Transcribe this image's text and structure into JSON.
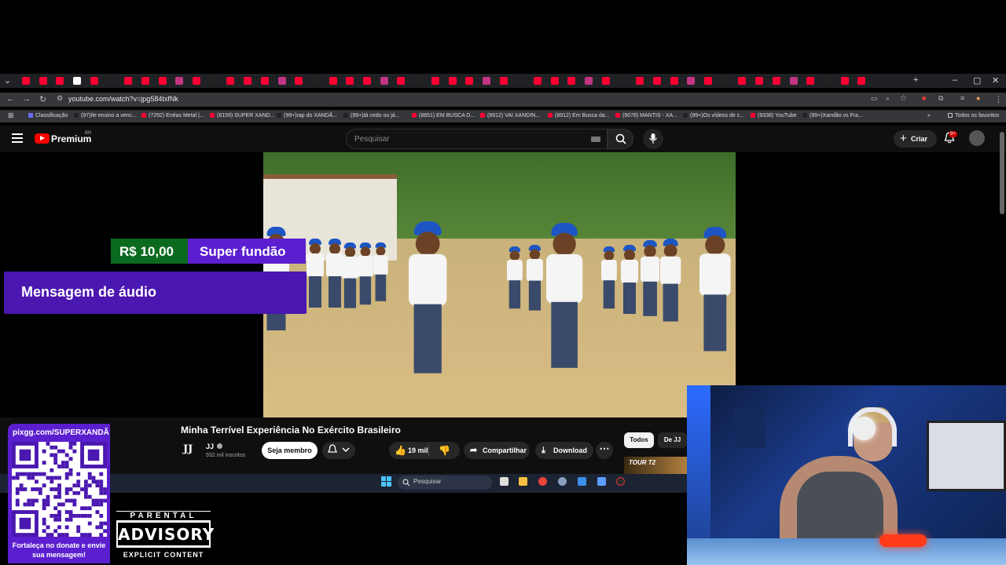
{
  "browser": {
    "url": "youtube.com/watch?v=jpg584txfNk",
    "bookmarks": [
      {
        "label": "Classificação",
        "color": "#6a6cf0"
      },
      {
        "label": "(97)Ile ensino a venc...",
        "color": "#222222"
      },
      {
        "label": "(7292) Enéas Metal |...",
        "color": "#ff0033"
      },
      {
        "label": "(8159) SUPER XAND...",
        "color": "#ff0033"
      },
      {
        "label": "(99+)rap do XANDÃ...",
        "color": "#222222"
      },
      {
        "label": "(99+)tá cedo ou já...",
        "color": "#222222"
      },
      {
        "label": "(8851) EM BUSCA D...",
        "color": "#ff0033"
      },
      {
        "label": "(8912) VAI XANDIN...",
        "color": "#ff0033"
      },
      {
        "label": "(8912) Em Busca da...",
        "color": "#ff0033"
      },
      {
        "label": "(9078) MANTIS - XA...",
        "color": "#ff0033"
      },
      {
        "label": "(99+)Os vídeos de c...",
        "color": "#222222"
      },
      {
        "label": "(9338) YouTube",
        "color": "#ff0033"
      },
      {
        "label": "(99+)Xandão vs Fra...",
        "color": "#222222"
      }
    ],
    "all_bookmarks": "Todos os favoritos"
  },
  "youtube": {
    "brand": "Premium",
    "country": "BR",
    "search_placeholder": "Pesquisar",
    "create_label": "Criar",
    "notification_badge": "9+"
  },
  "superchat": {
    "amount": "R$ 10,00",
    "title": "Super fundão",
    "message": "Mensagem de áudio"
  },
  "video": {
    "title": "Minha Terrível Experiência No Exército Brasileiro",
    "channel_logo": "JJ",
    "channel": "JJ",
    "subscribers": "932 mil inscritos",
    "join_label": "Seja membro",
    "likes": "19 mil",
    "share_label": "Compartilhar",
    "download_label": "Download",
    "more_label": "⋯"
  },
  "filters": {
    "all": "Todos",
    "from_channel": "De JJ"
  },
  "suggestion_thumb_text": "TOUR T2",
  "taskbar": {
    "search_placeholder": "Pesquisar"
  },
  "donate": {
    "url": "pixgg.com/SUPERXANDÃ",
    "text": "Fortaleça no donate e envie sua mensagem!"
  },
  "advisory": {
    "top": "PARENTAL",
    "middle": "ADVISORY",
    "bottom": "EXPLICIT CONTENT"
  },
  "colors": {
    "superchat_green": "#0a6a1e",
    "superchat_purple": "#5b1fcf",
    "youtube_red": "#ff0000"
  }
}
